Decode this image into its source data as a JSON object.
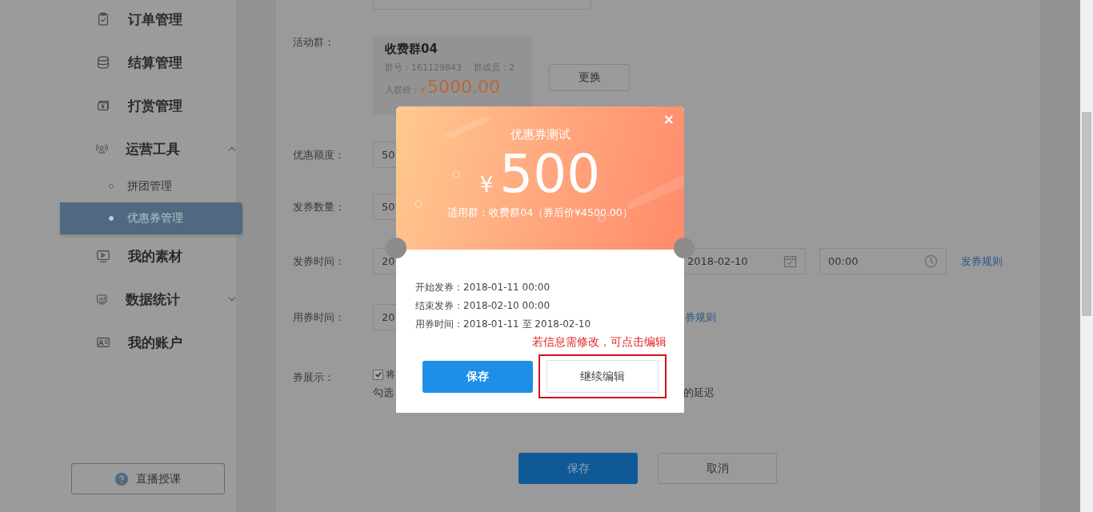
{
  "sidebar": {
    "items": [
      {
        "kind": "clipboard",
        "label": "订单管理",
        "selected": false
      },
      {
        "kind": "coins",
        "label": "结算管理",
        "selected": false
      },
      {
        "kind": "cash",
        "label": "打赏管理",
        "selected": false
      },
      {
        "kind": "broadcast",
        "label": "运营工具",
        "selected": false,
        "expanded": true,
        "children": [
          {
            "label": "拼团管理",
            "selected": false
          },
          {
            "label": "优惠券管理",
            "selected": true
          }
        ]
      },
      {
        "kind": "video",
        "label": "我的素材",
        "selected": false
      },
      {
        "kind": "chart",
        "label": "数据统计",
        "selected": false,
        "expanded": false
      },
      {
        "kind": "idcard",
        "label": "我的账户",
        "selected": false
      }
    ],
    "live_button": "直播授课"
  },
  "form": {
    "group_label": "活动群：",
    "group": {
      "name": "收费群04",
      "number": "群号：161129843",
      "members": "群成员：2",
      "price_label": "入群价：",
      "currency": "¥",
      "price": "5000.00"
    },
    "change_button": "更换",
    "amount_label": "优惠额度：",
    "amount": "50",
    "count_label": "发券数量：",
    "count": "50",
    "issue_label": "发券时间：",
    "issue_start": "20",
    "issue_end_date": "2018-02-10",
    "issue_end_time": "00:00",
    "issue_rule": "发券规则",
    "use_label": "用券时间：",
    "use_start": "20",
    "use_rule": "券规则",
    "display_label": "券展示：",
    "display_checked": true,
    "display_text": "将",
    "hint_start": "勾选",
    "hint_end": "的延迟",
    "save": "保存",
    "cancel": "取消"
  },
  "dialog": {
    "close": "×",
    "title": "优惠券测试",
    "currency": "¥",
    "amount": "500",
    "applies": "适用群：收费群04（券后价¥4500.00）",
    "lines": [
      "开始发券：2018-01-11 00:00",
      "结束发券：2018-02-10 00:00",
      "用券时间：2018-01-11 至 2018-02-10"
    ],
    "hint": "若信息需修改，可点击编辑",
    "save": "保存",
    "continue": "继续编辑"
  }
}
